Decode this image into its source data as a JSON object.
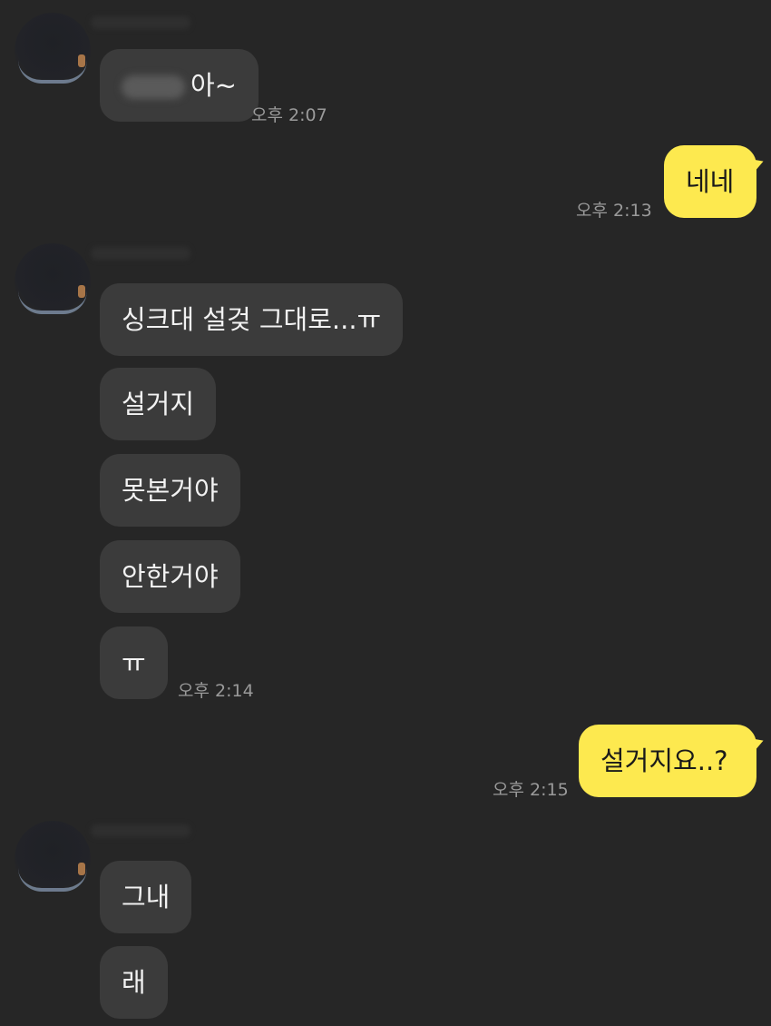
{
  "colors": {
    "background": "#262626",
    "incoming_bubble": "#3b3b3b",
    "outgoing_bubble": "#fde94f",
    "timestamp": "#9a9a9a"
  },
  "messages": [
    {
      "from": "other",
      "text": "아~",
      "time": "오후 2:07"
    },
    {
      "from": "me",
      "text": "네네",
      "time": "오후 2:13"
    },
    {
      "from": "other",
      "text": "싱크대 설겆 그대로...ㅠ"
    },
    {
      "from": "other",
      "text": "설거지"
    },
    {
      "from": "other",
      "text": "못본거야"
    },
    {
      "from": "other",
      "text": "안한거야"
    },
    {
      "from": "other",
      "text": "ㅠ",
      "time": "오후 2:14"
    },
    {
      "from": "me",
      "text": "설거지요..?",
      "time": "오후 2:15"
    },
    {
      "from": "other",
      "text": "그내"
    },
    {
      "from": "other",
      "text": "래"
    }
  ]
}
